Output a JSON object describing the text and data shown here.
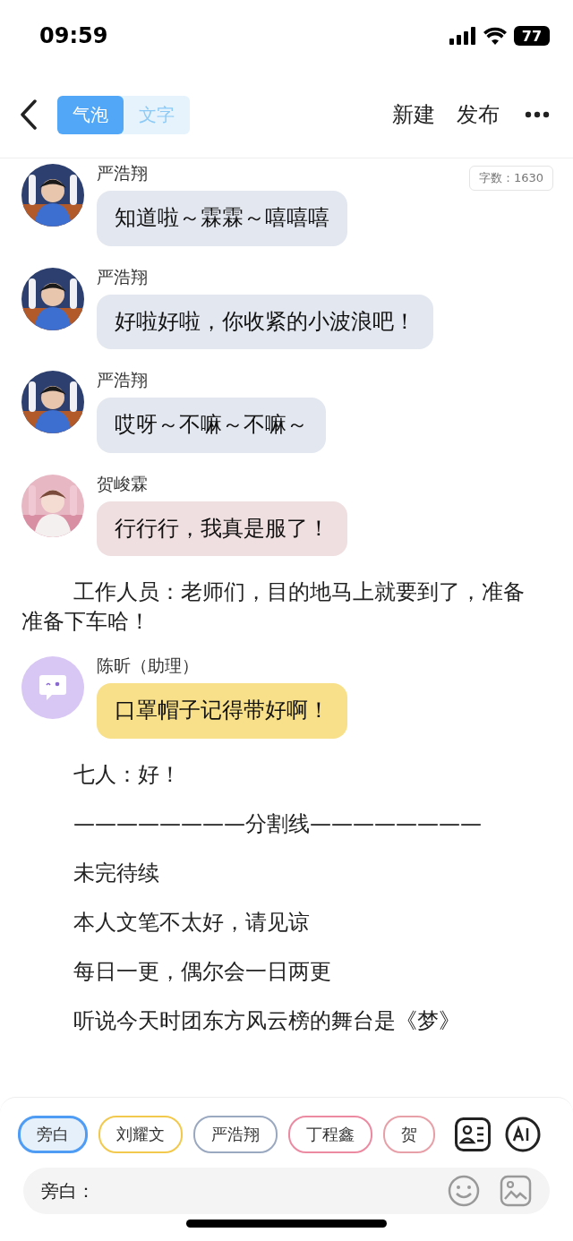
{
  "status_bar": {
    "time": "09:59",
    "battery": "77"
  },
  "header": {
    "tabs": [
      {
        "label": "气泡",
        "selected": true
      },
      {
        "label": "文字",
        "selected": false
      }
    ],
    "actions": [
      "新建",
      "发布"
    ]
  },
  "word_count": "字数：1630",
  "messages": [
    {
      "kind": "bubble",
      "name": "严浩翔",
      "text": "知道啦～霖霖～嘻嘻嘻",
      "color": "#e3e7ef"
    },
    {
      "kind": "bubble",
      "name": "严浩翔",
      "text": "好啦好啦，你收紧的小波浪吧！",
      "color": "#e3e7ef"
    },
    {
      "kind": "bubble",
      "name": "严浩翔",
      "text": "哎呀～不嘛～不嘛～",
      "color": "#e3e7ef"
    },
    {
      "kind": "bubble",
      "name": "贺峻霖",
      "text": "行行行，我真是服了！",
      "color": "#f0dfe0"
    },
    {
      "kind": "narration",
      "text": "工作人员：老师们，目的地马上就要到了，准备准备下车哈！"
    },
    {
      "kind": "bubble",
      "avatar": {
        "kind": "icon"
      },
      "name": "陈昕（助理）",
      "text": "口罩帽子记得带好啊！",
      "color": "#f8e08a"
    },
    {
      "kind": "narration",
      "text": "七人：好！"
    },
    {
      "kind": "narration",
      "text": "————————分割线————————"
    },
    {
      "kind": "narration",
      "text": "未完待续"
    },
    {
      "kind": "narration",
      "text": "本人文笔不太好，请见谅"
    },
    {
      "kind": "narration",
      "text": "每日一更，偶尔会一日两更"
    },
    {
      "kind": "narration",
      "text": "听说今天时团东方风云榜的舞台是《梦》"
    }
  ],
  "roles": [
    {
      "label": "旁白",
      "selected": true,
      "color": "#4f9cf5"
    },
    {
      "label": "刘耀文",
      "selected": false,
      "color": "#f2c94c"
    },
    {
      "label": "严浩翔",
      "selected": false,
      "color": "#9aa8c0"
    },
    {
      "label": "丁程鑫",
      "selected": false,
      "color": "#ec8aa2"
    },
    {
      "label": "贺",
      "selected": false,
      "color": "#e8a0a8"
    }
  ],
  "input": {
    "prefix": "旁白："
  }
}
